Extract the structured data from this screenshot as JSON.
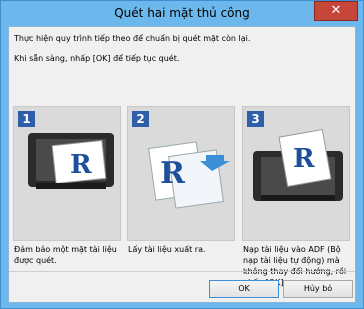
{
  "window": {
    "title": "Quét hai mặt thủ công",
    "close_symbol": "✕"
  },
  "message": {
    "line1": "Thực hiện quy trình tiếp theo để chuẩn bị quét mặt còn lại.",
    "line2": "Khi sẵn sàng, nhấp [OK] để tiếp tục quét."
  },
  "steps": [
    {
      "number": "1",
      "caption": "Đảm bảo một mặt tài liệu được quét.",
      "icon": "scanner-document-icon"
    },
    {
      "number": "2",
      "caption": "Lấy tài liệu xuất ra.",
      "icon": "remove-document-icon"
    },
    {
      "number": "3",
      "caption": "Nạp tài liệu vào ADF (Bộ nạp tài liệu tự động) mà không thay đổi hướng, rồi nhấp [OK].",
      "icon": "load-adf-icon"
    }
  ],
  "buttons": {
    "ok": "OK",
    "cancel": "Hủy bỏ"
  },
  "colors": {
    "accent": "#2f5fa8",
    "titlebar": "#6cb8ec",
    "close": "#c7463a"
  }
}
